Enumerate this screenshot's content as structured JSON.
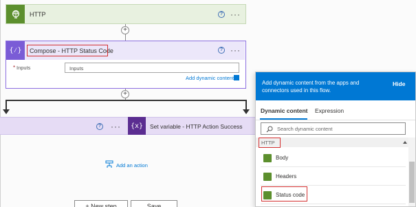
{
  "http_card": {
    "title": "HTTP"
  },
  "compose_card": {
    "title": "Compose - HTTP Status Code",
    "inputs_label": "Inputs",
    "inputs_value": "Inputs",
    "add_dynamic_content": "Add dynamic content"
  },
  "setvar_card": {
    "title": "Set variable - HTTP Action Success"
  },
  "add_action": "Add an action",
  "bottom_buttons": {
    "new_step": "+ New step",
    "save": "Save"
  },
  "dynamic_panel": {
    "header_text": "Add dynamic content from the apps and connectors used in this flow.",
    "hide": "Hide",
    "tabs": {
      "dynamic": "Dynamic content",
      "expression": "Expression"
    },
    "search_placeholder": "Search dynamic content",
    "section": "HTTP",
    "items": [
      "Body",
      "Headers",
      "Status code"
    ]
  },
  "colors": {
    "http_green": "#5c8f2d",
    "compose_purple": "#7a5cd6",
    "setvar_purple": "#5b2d91",
    "panel_blue": "#0078d4",
    "highlight_red": "#d32f2f"
  },
  "icons": {
    "http": "globe-icon",
    "compose": "curly-braces-icon",
    "setvar": "variable-x-icon",
    "add_action": "add-action-icon",
    "search": "search-icon"
  }
}
